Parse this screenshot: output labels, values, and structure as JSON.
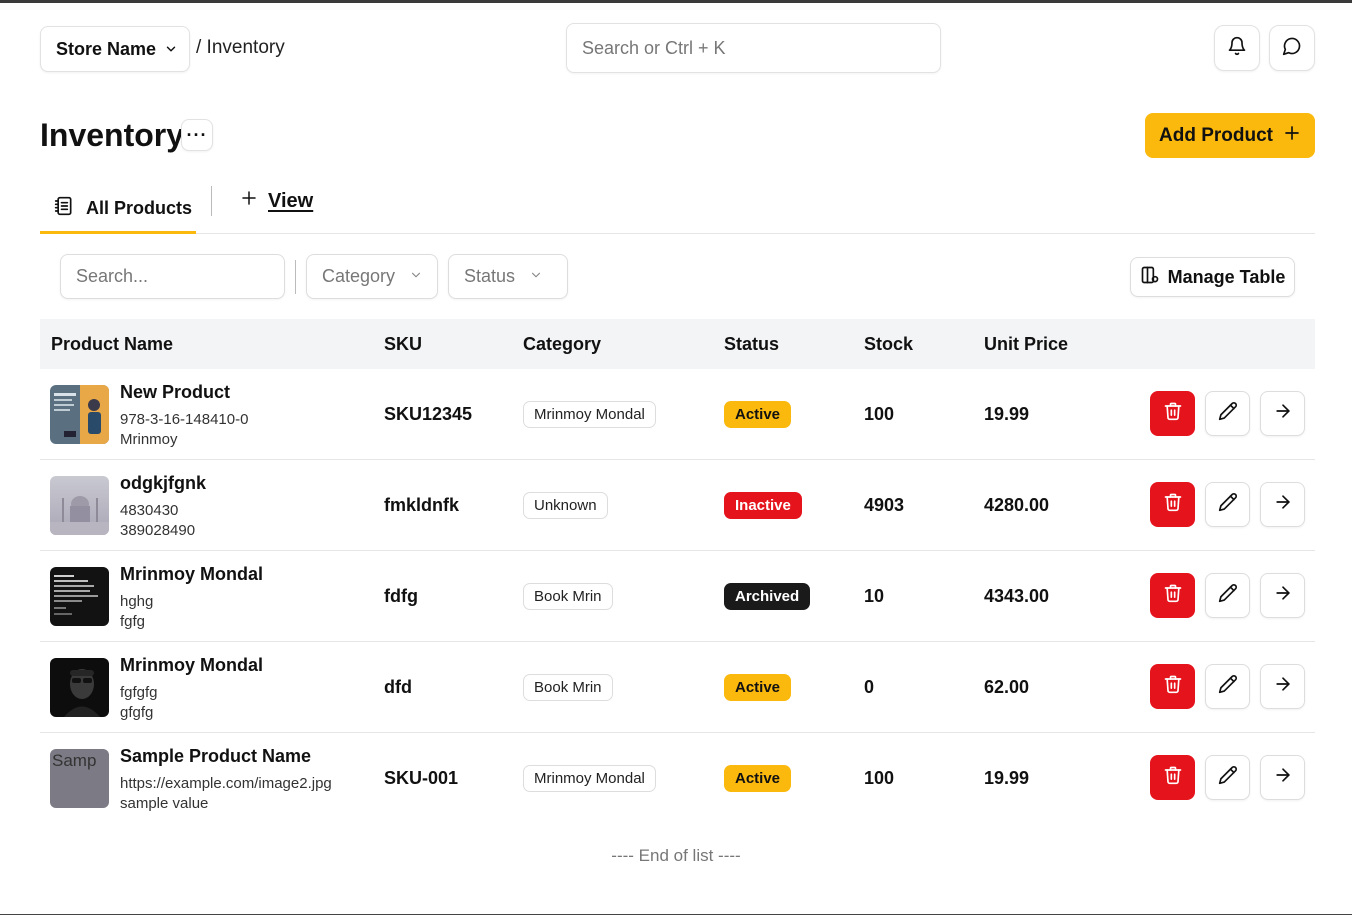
{
  "header": {
    "store_label": "Store Name",
    "breadcrumb": "/ Inventory",
    "search_placeholder": "Search or Ctrl + K"
  },
  "page": {
    "title": "Inventory",
    "more_label": "···",
    "add_product_label": "Add Product"
  },
  "tabs": {
    "all_products": "All Products",
    "view": "View"
  },
  "filters": {
    "search_placeholder": "Search...",
    "category_label": "Category",
    "status_label": "Status",
    "manage_table_label": "Manage Table"
  },
  "table": {
    "columns": [
      "Product Name",
      "SKU",
      "Category",
      "Status",
      "Stock",
      "Unit Price"
    ],
    "rows": [
      {
        "name": "New Product",
        "sub1": "978-3-16-148410-0",
        "sub2": "Mrinmoy",
        "sku": "SKU12345",
        "category": "Mrinmoy Mondal",
        "status": "Active",
        "stock": "100",
        "price": "19.99"
      },
      {
        "name": "odgkjfgnk",
        "sub1": "4830430",
        "sub2": "389028490",
        "sku": "fmkldnfk",
        "category": "Unknown",
        "status": "Inactive",
        "stock": "4903",
        "price": "4280.00"
      },
      {
        "name": "Mrinmoy Mondal",
        "sub1": "hghg",
        "sub2": "fgfg",
        "sku": "fdfg",
        "category": "Book Mrin",
        "status": "Archived",
        "stock": "10",
        "price": "4343.00"
      },
      {
        "name": "Mrinmoy Mondal",
        "sub1": "fgfgfg",
        "sub2": "gfgfg",
        "sku": "dfd",
        "category": "Book Mrin",
        "status": "Active",
        "stock": "0",
        "price": "62.00"
      },
      {
        "name": "Sample Product Name",
        "sub1": "https://example.com/image2.jpg",
        "sub2": "sample value",
        "sku": "SKU-001",
        "category": "Mrinmoy Mondal",
        "status": "Active",
        "stock": "100",
        "price": "19.99",
        "broken_image_alt": "Samp"
      }
    ]
  },
  "footer": {
    "end_of_list": "---- End of list ----"
  },
  "colors": {
    "accent": "#fbb90e",
    "danger": "#e5131c",
    "status_active_bg": "#fbb90e",
    "status_inactive_bg": "#e5131c",
    "status_archived_bg": "#1a1a1a"
  }
}
